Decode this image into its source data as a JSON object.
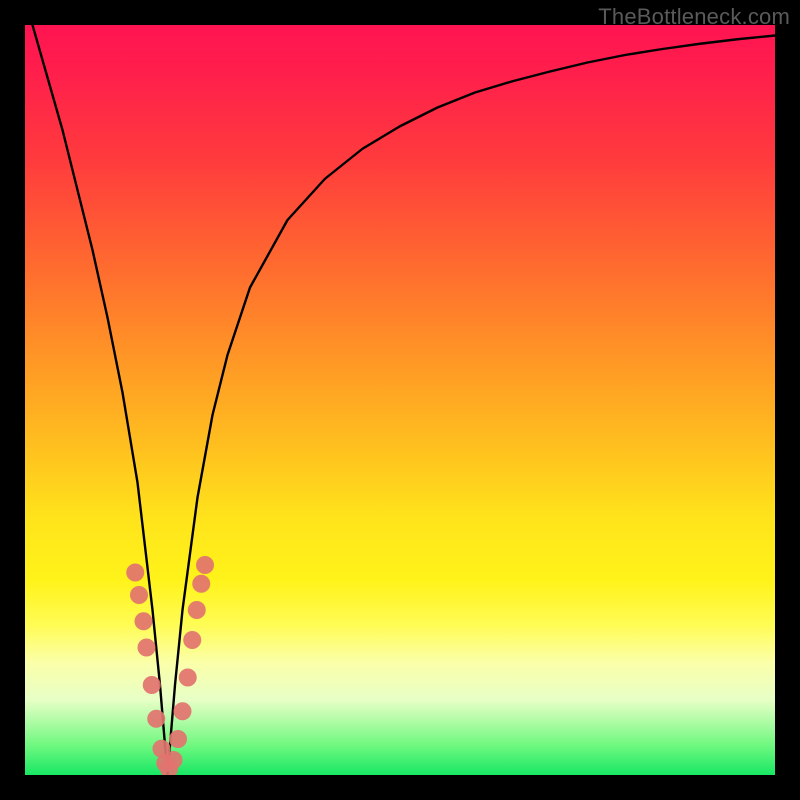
{
  "watermark": "TheBottleneck.com",
  "chart_data": {
    "type": "line",
    "title": "",
    "xlabel": "",
    "ylabel": "",
    "xlim": [
      0,
      100
    ],
    "ylim": [
      0,
      100
    ],
    "grid": false,
    "legend": null,
    "optimum_x": 19,
    "series": [
      {
        "name": "bottleneck-curve",
        "x": [
          1,
          3,
          5,
          7,
          9,
          11,
          13,
          15,
          17,
          18,
          19,
          20,
          21,
          23,
          25,
          27,
          30,
          35,
          40,
          45,
          50,
          55,
          60,
          65,
          70,
          75,
          80,
          85,
          90,
          95,
          100
        ],
        "y": [
          100,
          93,
          86,
          78,
          70,
          61,
          51,
          39,
          22,
          12,
          0,
          12,
          22,
          37,
          48,
          56,
          65,
          74,
          79.5,
          83.5,
          86.5,
          89,
          91,
          92.5,
          93.8,
          95,
          96,
          96.8,
          97.5,
          98.1,
          98.6
        ]
      }
    ],
    "markers": {
      "name": "sample-dots",
      "color": "#e2736f",
      "points": [
        {
          "x": 14.7,
          "y": 27
        },
        {
          "x": 15.2,
          "y": 24
        },
        {
          "x": 15.8,
          "y": 20.5
        },
        {
          "x": 16.2,
          "y": 17
        },
        {
          "x": 16.9,
          "y": 12
        },
        {
          "x": 17.5,
          "y": 7.5
        },
        {
          "x": 18.2,
          "y": 3.5
        },
        {
          "x": 18.7,
          "y": 1.6
        },
        {
          "x": 19.2,
          "y": 0.8
        },
        {
          "x": 19.8,
          "y": 2
        },
        {
          "x": 20.4,
          "y": 4.8
        },
        {
          "x": 21.0,
          "y": 8.5
        },
        {
          "x": 21.7,
          "y": 13
        },
        {
          "x": 22.3,
          "y": 18
        },
        {
          "x": 22.9,
          "y": 22
        },
        {
          "x": 23.5,
          "y": 25.5
        },
        {
          "x": 24.0,
          "y": 28
        }
      ]
    },
    "background_gradient": {
      "top": "#ff1452",
      "mid_upper": "#ff6a2f",
      "mid": "#ffe41b",
      "mid_lower": "#fbffa9",
      "bottom": "#18e764"
    }
  }
}
